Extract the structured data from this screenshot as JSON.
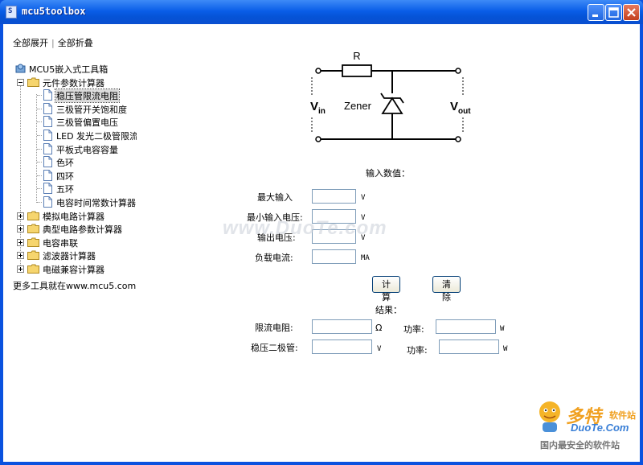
{
  "window": {
    "title": "mcu5toolbox"
  },
  "nav": {
    "expand_all": "全部展开",
    "collapse_all": "全部折叠",
    "separator": "|"
  },
  "tree": {
    "root": "MCU5嵌入式工具箱",
    "folder_open": "元件参数计算器",
    "children": [
      "稳压管限流电阻",
      "三极管开关饱和度",
      "三极管偏置电压",
      "LED 发光二极管限流",
      "平板式电容容量",
      "色环",
      "四环",
      "五环",
      "电容时间常数计算器"
    ],
    "folders_closed": [
      "模拟电路计算器",
      "典型电路参数计算器",
      "电容串联",
      "滤波器计算器",
      "电磁兼容计算器"
    ]
  },
  "footer_link": "更多工具就在www.mcu5.com",
  "circuit": {
    "r": "R",
    "zener": "Zener",
    "vin_main": "V",
    "vin_sub": "in",
    "vout_main": "V",
    "vout_sub": "out"
  },
  "form": {
    "input_title": "输入数值：",
    "rows": [
      {
        "label": "最大输入",
        "unit": "V"
      },
      {
        "label": "最小输入电压:",
        "unit": "V"
      },
      {
        "label": "输出电压:",
        "unit": "V"
      },
      {
        "label": "负载电流:",
        "unit": "MA"
      }
    ],
    "calc": "计算",
    "clear": "清除",
    "result_title": "结果：",
    "results": [
      {
        "label": "限流电阻:",
        "unit": "Ω",
        "power_label": "功率:",
        "power_unit": "W"
      },
      {
        "label": "稳压二极管:",
        "unit": "V",
        "power_label": "功率:",
        "power_unit": "W"
      }
    ]
  },
  "watermark": "www.DuoTe.com",
  "logo": {
    "cn": "多特",
    "sub": "软件站",
    "en": "DuoTe.Com",
    "tagline": "国内最安全的软件站"
  },
  "colors": {
    "titlebar": "#0a5ee8",
    "border": "#0a52df",
    "close": "#c2401e"
  },
  "icons": [
    "app-icon",
    "minimize-icon",
    "maximize-icon",
    "close-icon",
    "folder-icon",
    "document-icon",
    "toolbox-icon"
  ]
}
